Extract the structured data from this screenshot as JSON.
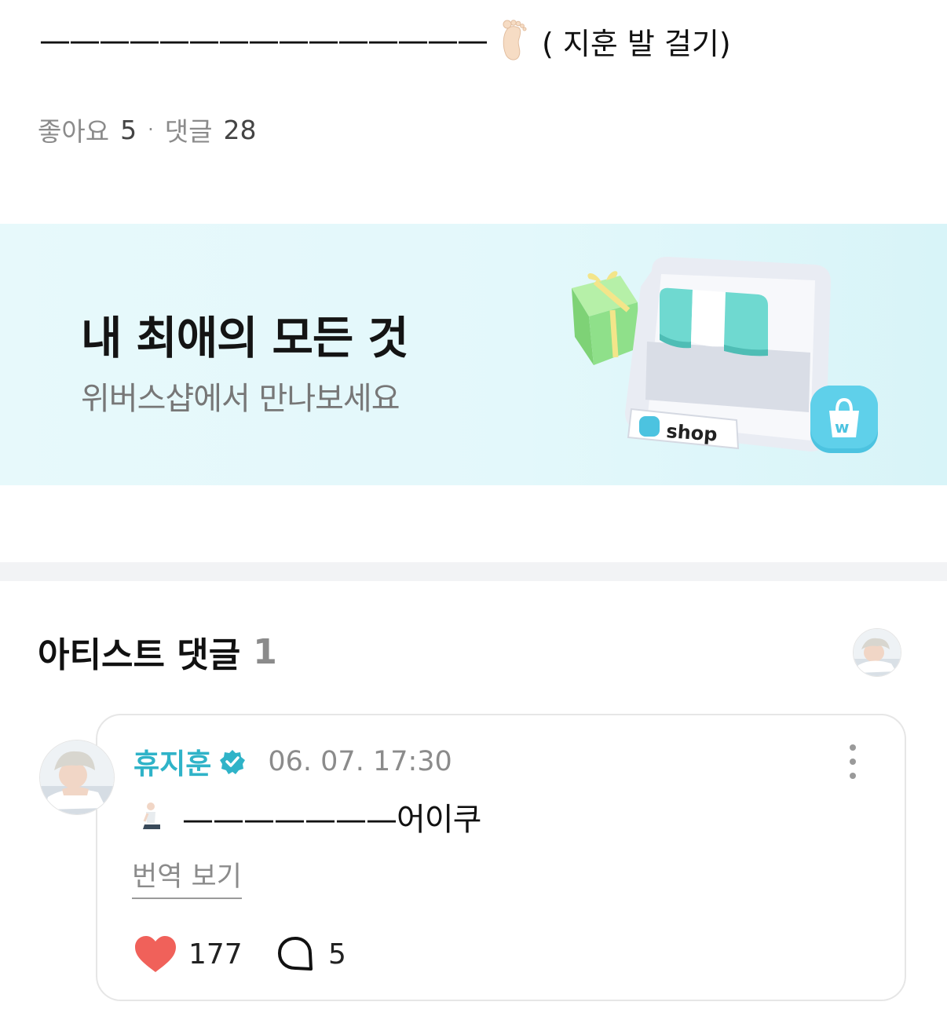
{
  "post": {
    "tail_dashes": "———————————————",
    "tail_text": "( 지훈 발 걸기)",
    "foot_icon": "foot-icon"
  },
  "stats": {
    "likes_label": "좋아요",
    "likes_count": "5",
    "separator": "·",
    "comments_label": "댓글",
    "comments_count": "28"
  },
  "banner": {
    "headline": "내 최애의 모든 것",
    "subtext": "위버스샵에서 만나보세요",
    "shop_label": "shop",
    "colors": {
      "background": "#e3f8fb",
      "mint": "#6fd9d0",
      "gift": "#8fe08a",
      "bag": "#4cc3e0"
    }
  },
  "artist_comments": {
    "title": "아티스트 댓글",
    "count": "1",
    "comment": {
      "author": "휴지훈",
      "date": "06. 07. 17:30",
      "text": "———————어이쿠",
      "translate_label": "번역 보기",
      "like_count": "177",
      "reply_count": "5"
    }
  },
  "colors": {
    "accent": "#2fb3c8",
    "heart": "#f0615a",
    "muted": "#8b8b8b"
  }
}
